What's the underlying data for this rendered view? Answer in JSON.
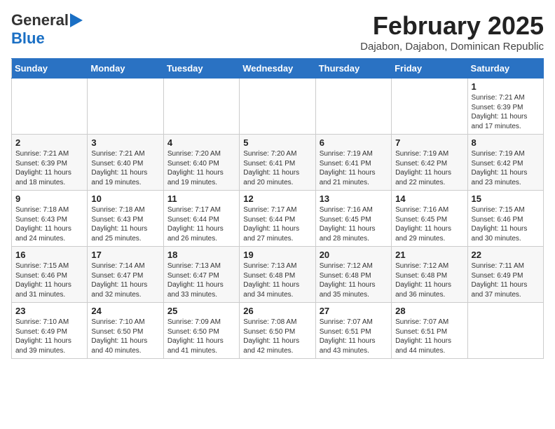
{
  "logo": {
    "line1": "General",
    "line2": "Blue",
    "arrow": true
  },
  "header": {
    "month": "February 2025",
    "location": "Dajabon, Dajabon, Dominican Republic"
  },
  "weekdays": [
    "Sunday",
    "Monday",
    "Tuesday",
    "Wednesday",
    "Thursday",
    "Friday",
    "Saturday"
  ],
  "weeks": [
    [
      {
        "day": "",
        "info": ""
      },
      {
        "day": "",
        "info": ""
      },
      {
        "day": "",
        "info": ""
      },
      {
        "day": "",
        "info": ""
      },
      {
        "day": "",
        "info": ""
      },
      {
        "day": "",
        "info": ""
      },
      {
        "day": "1",
        "info": "Sunrise: 7:21 AM\nSunset: 6:39 PM\nDaylight: 11 hours\nand 17 minutes."
      }
    ],
    [
      {
        "day": "2",
        "info": "Sunrise: 7:21 AM\nSunset: 6:39 PM\nDaylight: 11 hours\nand 18 minutes."
      },
      {
        "day": "3",
        "info": "Sunrise: 7:21 AM\nSunset: 6:40 PM\nDaylight: 11 hours\nand 19 minutes."
      },
      {
        "day": "4",
        "info": "Sunrise: 7:20 AM\nSunset: 6:40 PM\nDaylight: 11 hours\nand 19 minutes."
      },
      {
        "day": "5",
        "info": "Sunrise: 7:20 AM\nSunset: 6:41 PM\nDaylight: 11 hours\nand 20 minutes."
      },
      {
        "day": "6",
        "info": "Sunrise: 7:19 AM\nSunset: 6:41 PM\nDaylight: 11 hours\nand 21 minutes."
      },
      {
        "day": "7",
        "info": "Sunrise: 7:19 AM\nSunset: 6:42 PM\nDaylight: 11 hours\nand 22 minutes."
      },
      {
        "day": "8",
        "info": "Sunrise: 7:19 AM\nSunset: 6:42 PM\nDaylight: 11 hours\nand 23 minutes."
      }
    ],
    [
      {
        "day": "9",
        "info": "Sunrise: 7:18 AM\nSunset: 6:43 PM\nDaylight: 11 hours\nand 24 minutes."
      },
      {
        "day": "10",
        "info": "Sunrise: 7:18 AM\nSunset: 6:43 PM\nDaylight: 11 hours\nand 25 minutes."
      },
      {
        "day": "11",
        "info": "Sunrise: 7:17 AM\nSunset: 6:44 PM\nDaylight: 11 hours\nand 26 minutes."
      },
      {
        "day": "12",
        "info": "Sunrise: 7:17 AM\nSunset: 6:44 PM\nDaylight: 11 hours\nand 27 minutes."
      },
      {
        "day": "13",
        "info": "Sunrise: 7:16 AM\nSunset: 6:45 PM\nDaylight: 11 hours\nand 28 minutes."
      },
      {
        "day": "14",
        "info": "Sunrise: 7:16 AM\nSunset: 6:45 PM\nDaylight: 11 hours\nand 29 minutes."
      },
      {
        "day": "15",
        "info": "Sunrise: 7:15 AM\nSunset: 6:46 PM\nDaylight: 11 hours\nand 30 minutes."
      }
    ],
    [
      {
        "day": "16",
        "info": "Sunrise: 7:15 AM\nSunset: 6:46 PM\nDaylight: 11 hours\nand 31 minutes."
      },
      {
        "day": "17",
        "info": "Sunrise: 7:14 AM\nSunset: 6:47 PM\nDaylight: 11 hours\nand 32 minutes."
      },
      {
        "day": "18",
        "info": "Sunrise: 7:13 AM\nSunset: 6:47 PM\nDaylight: 11 hours\nand 33 minutes."
      },
      {
        "day": "19",
        "info": "Sunrise: 7:13 AM\nSunset: 6:48 PM\nDaylight: 11 hours\nand 34 minutes."
      },
      {
        "day": "20",
        "info": "Sunrise: 7:12 AM\nSunset: 6:48 PM\nDaylight: 11 hours\nand 35 minutes."
      },
      {
        "day": "21",
        "info": "Sunrise: 7:12 AM\nSunset: 6:48 PM\nDaylight: 11 hours\nand 36 minutes."
      },
      {
        "day": "22",
        "info": "Sunrise: 7:11 AM\nSunset: 6:49 PM\nDaylight: 11 hours\nand 37 minutes."
      }
    ],
    [
      {
        "day": "23",
        "info": "Sunrise: 7:10 AM\nSunset: 6:49 PM\nDaylight: 11 hours\nand 39 minutes."
      },
      {
        "day": "24",
        "info": "Sunrise: 7:10 AM\nSunset: 6:50 PM\nDaylight: 11 hours\nand 40 minutes."
      },
      {
        "day": "25",
        "info": "Sunrise: 7:09 AM\nSunset: 6:50 PM\nDaylight: 11 hours\nand 41 minutes."
      },
      {
        "day": "26",
        "info": "Sunrise: 7:08 AM\nSunset: 6:50 PM\nDaylight: 11 hours\nand 42 minutes."
      },
      {
        "day": "27",
        "info": "Sunrise: 7:07 AM\nSunset: 6:51 PM\nDaylight: 11 hours\nand 43 minutes."
      },
      {
        "day": "28",
        "info": "Sunrise: 7:07 AM\nSunset: 6:51 PM\nDaylight: 11 hours\nand 44 minutes."
      },
      {
        "day": "",
        "info": ""
      }
    ]
  ]
}
